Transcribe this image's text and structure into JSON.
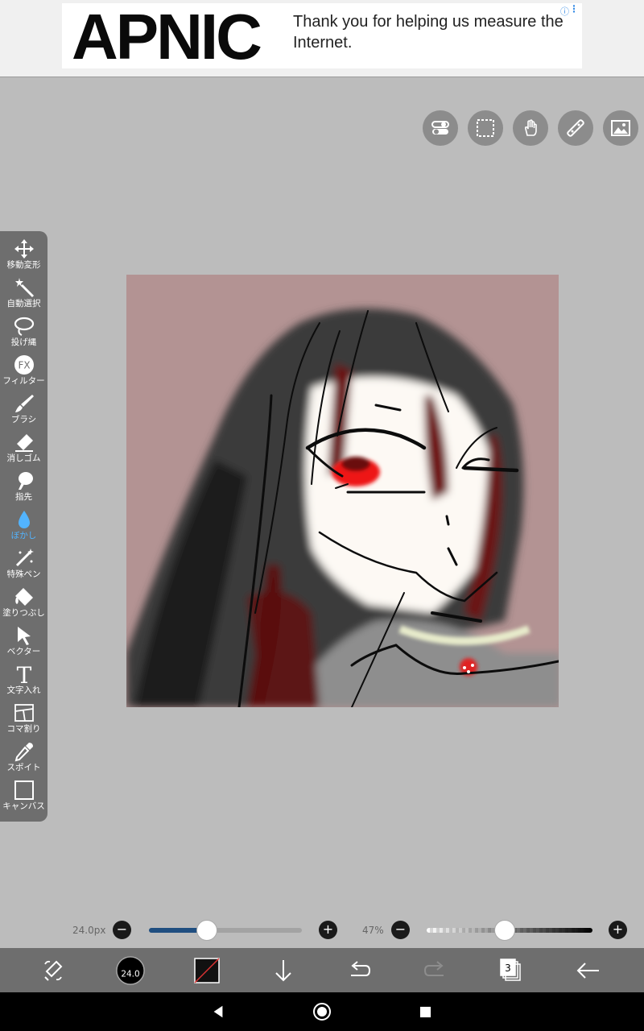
{
  "ad": {
    "logo": "APNIC",
    "text": "Thank you for helping us measure the Internet.",
    "info_glyph": "ⓘ",
    "close_glyph": "⋮"
  },
  "top_tools": [
    "toggle-icon",
    "selection-icon",
    "hand-icon",
    "ruler-icon",
    "image-icon"
  ],
  "toolbar": {
    "items": [
      {
        "label": "移動変形",
        "icon": "move-icon"
      },
      {
        "label": "自動選択",
        "icon": "magic-wand-icon"
      },
      {
        "label": "投げ縄",
        "icon": "lasso-icon"
      },
      {
        "label": "フィルター",
        "icon": "fx-icon"
      },
      {
        "label": "ブラシ",
        "icon": "brush-icon"
      },
      {
        "label": "消しゴム",
        "icon": "eraser-icon"
      },
      {
        "label": "指先",
        "icon": "finger-icon"
      },
      {
        "label": "ぼかし",
        "icon": "blur-drop-icon",
        "active": true
      },
      {
        "label": "特殊ペン",
        "icon": "special-pen-icon"
      },
      {
        "label": "塗りつぶし",
        "icon": "fill-icon"
      },
      {
        "label": "ベクター",
        "icon": "vector-icon"
      },
      {
        "label": "文字入れ",
        "icon": "text-icon"
      },
      {
        "label": "コマ割り",
        "icon": "frame-icon"
      },
      {
        "label": "スポイト",
        "icon": "eyedropper-icon"
      },
      {
        "label": "キャンバス",
        "icon": "canvas-icon"
      }
    ],
    "fx_text": "FX",
    "text_glyph": "T",
    "active_color": "#52b4ff"
  },
  "sliders": {
    "size_value": "24.0px",
    "size_level": 0.38,
    "opacity_value": "47%",
    "opacity_level": 0.47,
    "minus": "−",
    "plus": "+"
  },
  "actionbar": {
    "brush_size": "24.0",
    "layer_count": "3",
    "icons": [
      "swap-tool-icon",
      "brush-size-icon",
      "color-icon",
      "download-icon",
      "undo-icon",
      "redo-icon",
      "layers-icon",
      "back-icon"
    ]
  },
  "colors": {
    "canvas_bg": "#b39393",
    "workspace": "#bcbcbc",
    "toolbar": "#6e6e6e",
    "slider_accent": "#1f4e80"
  }
}
